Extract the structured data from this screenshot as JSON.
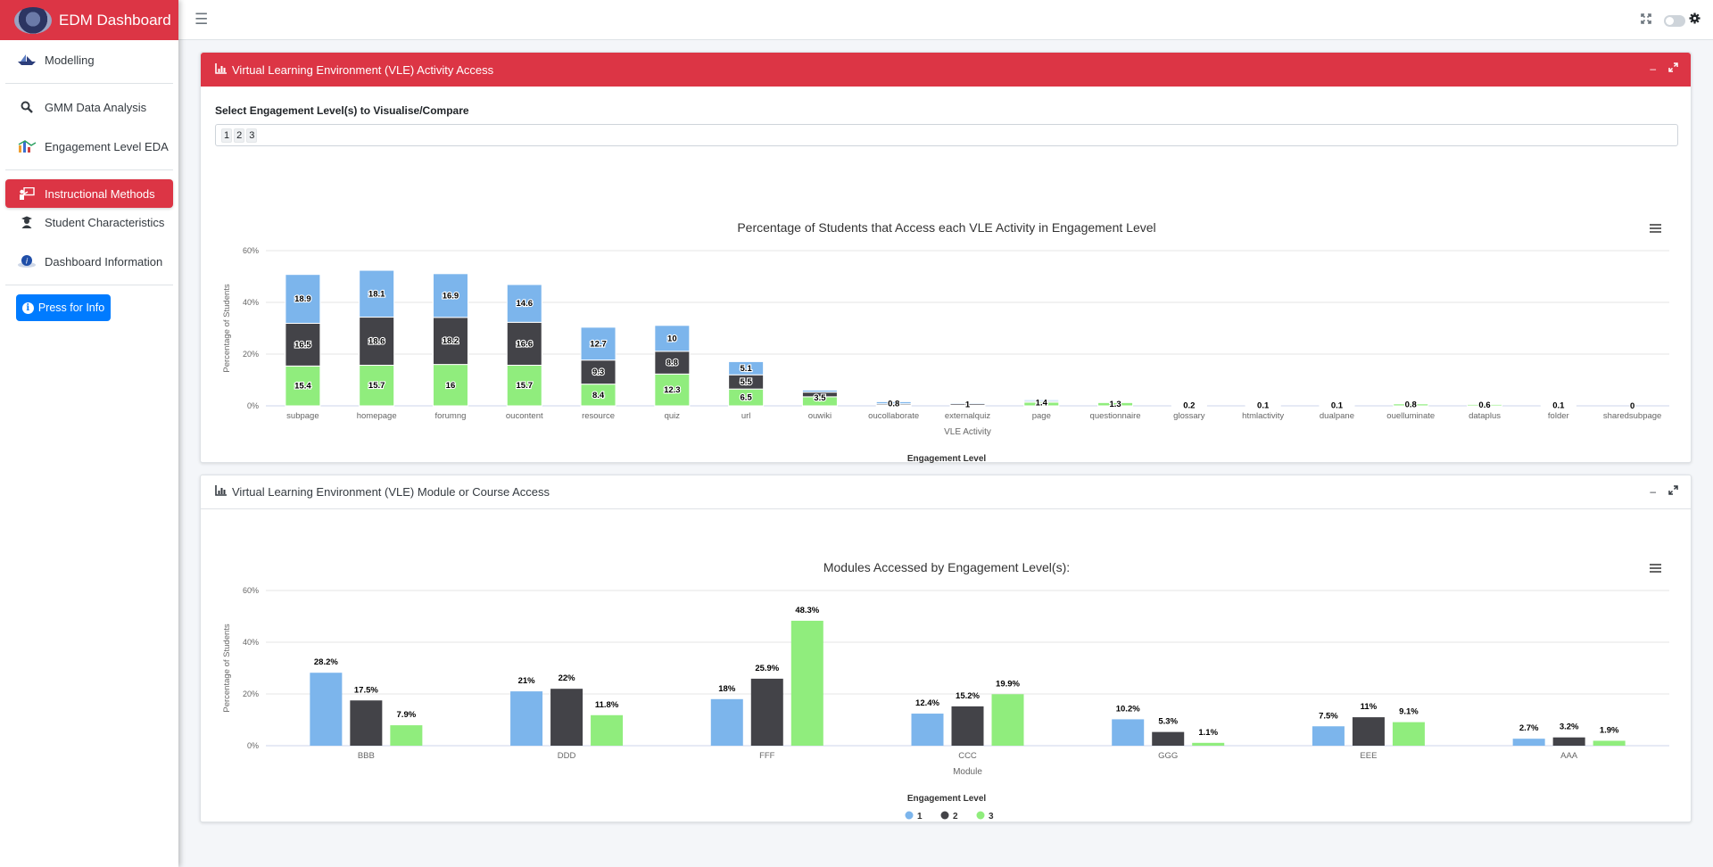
{
  "app": {
    "title": "EDM Dashboard"
  },
  "sidebar": {
    "items": [
      {
        "label": "Modelling",
        "icon": "ship-icon"
      },
      {
        "label": "GMM Data Analysis",
        "icon": "magnifier-icon"
      },
      {
        "label": "Engagement Level EDA",
        "icon": "chart-icon"
      },
      {
        "label": "Instructional Methods",
        "icon": "chalkboard-teacher-icon"
      },
      {
        "label": "Student Characteristics",
        "icon": "user-graduate-icon"
      },
      {
        "label": "Dashboard Information",
        "icon": "info-icon"
      }
    ],
    "info_button": "Press for Info"
  },
  "card1": {
    "title": "Virtual Learning Environment (VLE) Activity Access",
    "select_label": "Select Engagement Level(s) to Visualise/Compare",
    "selected": [
      "1",
      "2",
      "3"
    ]
  },
  "card2": {
    "title": "Virtual Learning Environment (VLE) Module or Course Access"
  },
  "colors": {
    "level1": "#7cb5ec",
    "level2": "#434348",
    "level3": "#90ed7d",
    "accent": "#dc3545",
    "info": "#007bff"
  },
  "chart_data": [
    {
      "type": "bar",
      "stacked": true,
      "title": "Percentage of Students that Access each VLE Activity in Engagement Level",
      "xlabel": "VLE Activity",
      "ylabel": "Percentage of Students",
      "ylim": [
        0,
        60
      ],
      "yticks": [
        "0%",
        "20%",
        "40%",
        "60%"
      ],
      "legend_title": "Engagement Level",
      "categories": [
        "subpage",
        "homepage",
        "forumng",
        "oucontent",
        "resource",
        "quiz",
        "url",
        "ouwiki",
        "oucollaborate",
        "externalquiz",
        "page",
        "questionnaire",
        "glossary",
        "htmlactivity",
        "dualpane",
        "ouelluminate",
        "dataplus",
        "folder",
        "sharedsubpage"
      ],
      "series": [
        {
          "name": "1",
          "values": [
            18.9,
            18.1,
            16.9,
            14.6,
            12.7,
            10,
            5.1,
            0.8,
            0.8,
            0.4,
            0.5,
            0.1,
            0.1,
            0.1,
            0.1,
            0.1,
            0.1,
            0.1,
            0
          ]
        },
        {
          "name": "2",
          "values": [
            16.5,
            18.6,
            18.2,
            16.6,
            9.3,
            8.8,
            5.5,
            1.8,
            0.5,
            0.6,
            0.4,
            0.1,
            0.1,
            0,
            0,
            0,
            0.1,
            0,
            0
          ]
        },
        {
          "name": "3",
          "values": [
            15.4,
            15.7,
            16,
            15.7,
            8.4,
            12.3,
            6.5,
            3.5,
            0.3,
            0.2,
            1.4,
            1.3,
            0.2,
            0.1,
            0.1,
            0.8,
            0.6,
            0.1,
            0
          ]
        }
      ],
      "data_labels": [
        "18.9",
        "18.1",
        "16.9",
        "14.6",
        "12.7",
        "10",
        "5.1",
        "16.5",
        "18.6",
        "18.2",
        "16.6",
        "9.3",
        "8.8",
        "5.5",
        "15.4",
        "15.7",
        "16",
        "15.7",
        "8.4",
        "12.3",
        "6.5",
        "3.5",
        "0.8",
        "1",
        "1.4",
        "1.3",
        "0.2",
        "0.1",
        "0.1",
        "0.8",
        "0.6",
        "0.1",
        "0"
      ]
    },
    {
      "type": "bar",
      "title": "Modules Accessed by Engagement Level(s):",
      "xlabel": "Module",
      "ylabel": "Percentage of Students",
      "ylim": [
        0,
        60
      ],
      "yticks": [
        "0%",
        "20%",
        "40%",
        "60%"
      ],
      "legend_title": "Engagement Level",
      "categories": [
        "BBB",
        "DDD",
        "FFF",
        "CCC",
        "GGG",
        "EEE",
        "AAA"
      ],
      "series": [
        {
          "name": "1",
          "values": [
            28.2,
            21,
            18,
            12.4,
            10.2,
            7.5,
            2.7
          ],
          "labels": [
            "28.2%",
            "21%",
            "18%",
            "12.4%",
            "10.2%",
            "7.5%",
            "2.7%"
          ]
        },
        {
          "name": "2",
          "values": [
            17.5,
            22,
            25.9,
            15.2,
            5.3,
            11,
            3.2
          ],
          "labels": [
            "17.5%",
            "22%",
            "25.9%",
            "15.2%",
            "5.3%",
            "11%",
            "3.2%"
          ]
        },
        {
          "name": "3",
          "values": [
            7.9,
            11.8,
            48.3,
            19.9,
            1.1,
            9.1,
            1.9
          ],
          "labels": [
            "7.9%",
            "11.8%",
            "48.3%",
            "19.9%",
            "1.1%",
            "9.1%",
            "1.9%"
          ]
        }
      ]
    }
  ]
}
